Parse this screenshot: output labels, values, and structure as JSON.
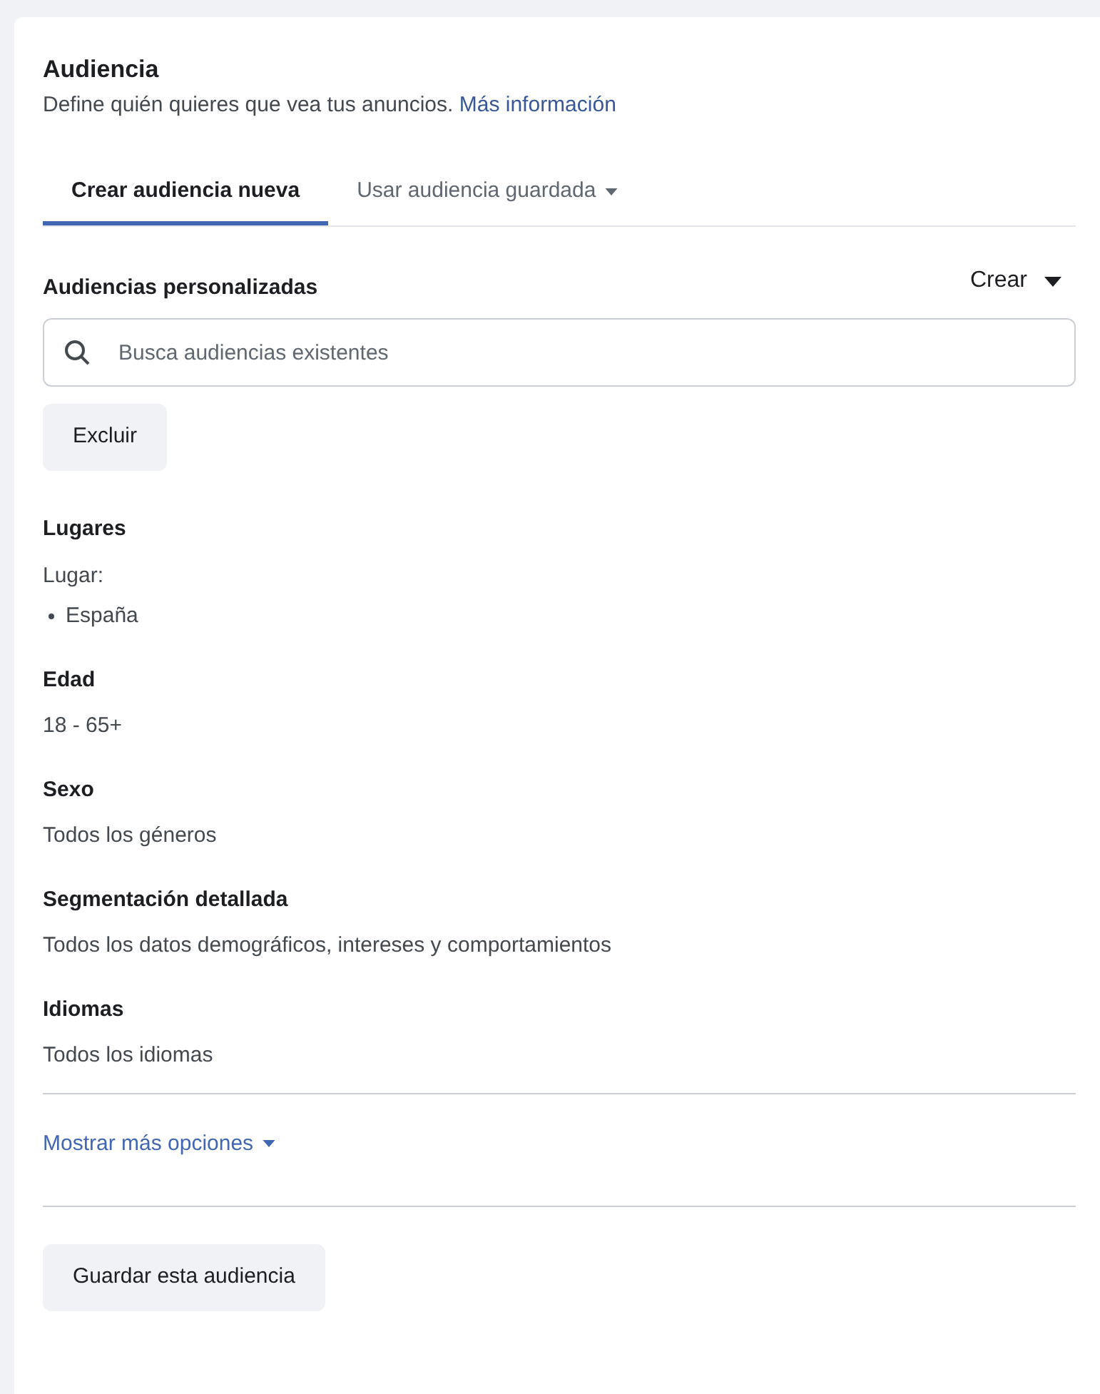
{
  "header": {
    "title": "Audiencia",
    "description": "Define quién quieres que vea tus anuncios.",
    "link": "Más información"
  },
  "tabs": [
    {
      "label": "Crear audiencia nueva",
      "selected": true,
      "dropdown": false
    },
    {
      "label": "Usar audiencia guardada",
      "selected": false,
      "dropdown": true
    }
  ],
  "custom_audiences": {
    "title": "Audiencias personalizadas",
    "create_menu": "Crear",
    "search": {
      "placeholder": "Busca audiencias existentes"
    },
    "exclude_button": "Excluir"
  },
  "sections": [
    {
      "title": "Lugares",
      "lines": [
        "Lugar:"
      ],
      "bullets": [
        "España"
      ]
    },
    {
      "title": "Edad",
      "lines": [
        "18 - 65+"
      ]
    },
    {
      "title": "Sexo",
      "lines": [
        "Todos los géneros"
      ]
    },
    {
      "title": "Segmentación detallada",
      "lines": [
        "Todos los datos demográficos, intereses y comportamientos"
      ]
    },
    {
      "title": "Idiomas",
      "lines": [
        "Todos los idiomas"
      ]
    }
  ],
  "more_options": "Mostrar más opciones",
  "save_button": "Guardar esta audiencia"
}
